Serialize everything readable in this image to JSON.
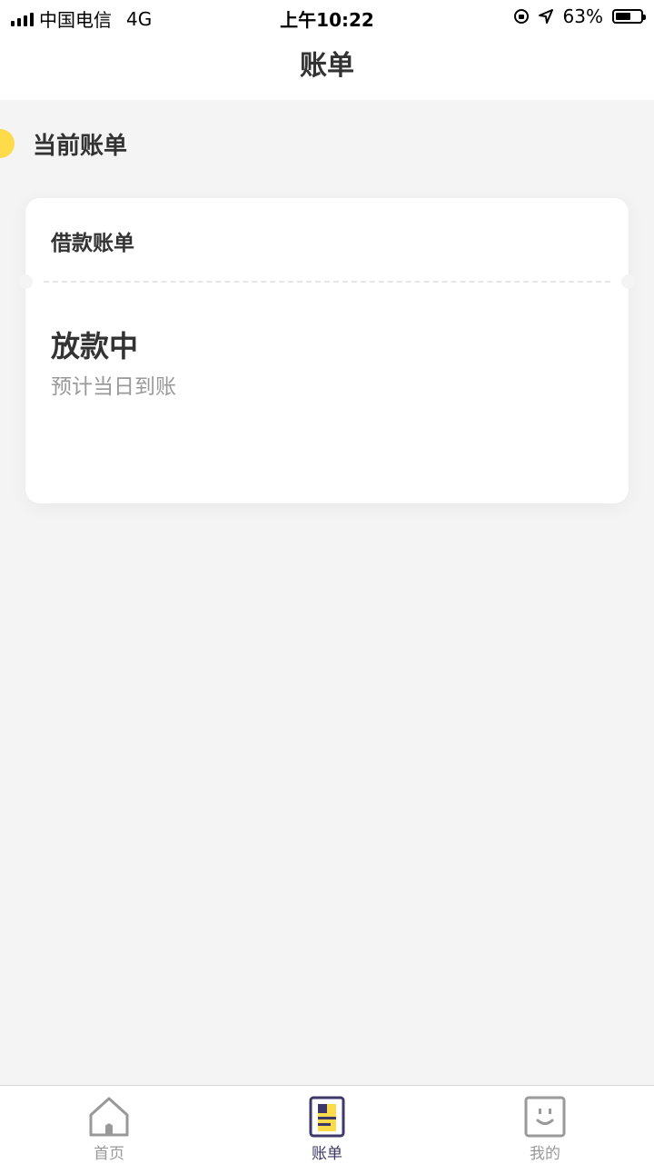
{
  "status_bar": {
    "carrier": "中国电信",
    "network": "4G",
    "time": "上午10:22",
    "battery": "63%",
    "battery_level": 0.63
  },
  "nav": {
    "title": "账单"
  },
  "section": {
    "title": "当前账单"
  },
  "card": {
    "title": "借款账单",
    "status": "放款中",
    "subtitle": "预计当日到账"
  },
  "tabs": [
    {
      "label": "首页",
      "icon": "home-icon"
    },
    {
      "label": "账单",
      "icon": "bill-icon",
      "active": true
    },
    {
      "label": "我的",
      "icon": "profile-icon"
    }
  ],
  "colors": {
    "accent": "#fddb4a",
    "active_tab": "#3d3868",
    "background": "#f4f4f4"
  }
}
